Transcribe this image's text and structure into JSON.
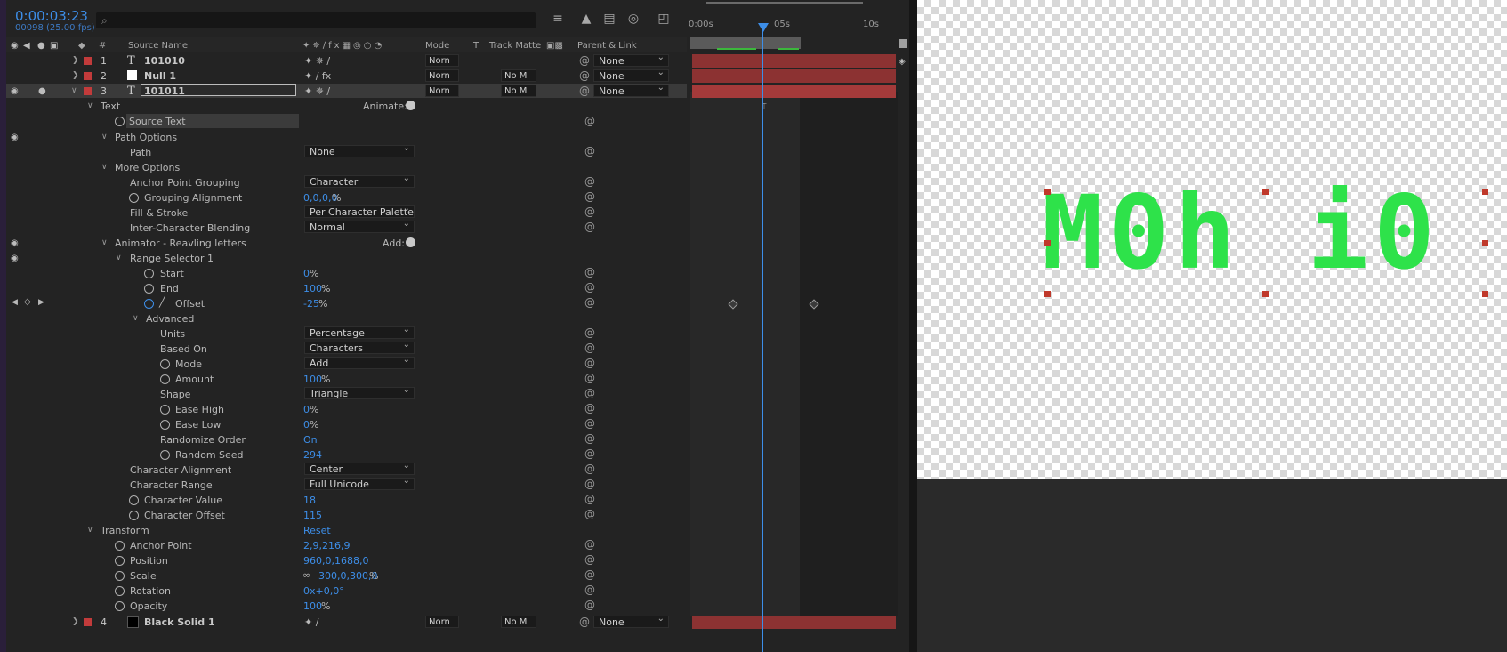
{
  "timecode": "0:00:03:23",
  "frame_info": "00098 (25.00 fps)",
  "search": {
    "placeholder": ""
  },
  "ruler": {
    "labels": [
      "0:00s",
      "05s",
      "10s"
    ]
  },
  "columns": {
    "number": "#",
    "source_name": "Source Name",
    "mode": "Mode",
    "t": "T",
    "track_matte": "Track Matte",
    "parent_link": "Parent & Link"
  },
  "layers": [
    {
      "num": "1",
      "name": "101010",
      "mode": "Norn",
      "matte": "",
      "parent": "None",
      "type": "T"
    },
    {
      "num": "2",
      "name": "Null 1",
      "mode": "Norn",
      "matte": "No M",
      "parent": "None",
      "type": "null"
    },
    {
      "num": "3",
      "name": "101011",
      "mode": "Norn",
      "matte": "No M",
      "parent": "None",
      "type": "T"
    },
    {
      "num": "4",
      "name": "Black Solid 1",
      "mode": "Norn",
      "matte": "No M",
      "parent": "None",
      "type": "solid"
    }
  ],
  "props": {
    "text": "Text",
    "animate": "Animate:",
    "source_text": "Source Text",
    "path_options": "Path Options",
    "path": "Path",
    "path_val": "None",
    "more_options": "More Options",
    "anchor_grouping": "Anchor Point Grouping",
    "anchor_grouping_val": "Character",
    "grouping_alignment": "Grouping Alignment",
    "grouping_alignment_val": "0,0,0,0",
    "fill_stroke": "Fill & Stroke",
    "fill_stroke_val": "Per Character Palette",
    "inter_char": "Inter-Character Blending",
    "inter_char_val": "Normal",
    "animator": "Animator - Reavling letters",
    "add": "Add:",
    "range_selector": "Range Selector 1",
    "start": "Start",
    "start_val": "0",
    "end": "End",
    "end_val": "100",
    "offset": "Offset",
    "offset_val": "-25",
    "advanced": "Advanced",
    "units": "Units",
    "units_val": "Percentage",
    "based_on": "Based On",
    "based_on_val": "Characters",
    "mode": "Mode",
    "mode_val": "Add",
    "amount": "Amount",
    "amount_val": "100",
    "shape": "Shape",
    "shape_val": "Triangle",
    "ease_high": "Ease High",
    "ease_high_val": "0",
    "ease_low": "Ease Low",
    "ease_low_val": "0",
    "randomize": "Randomize Order",
    "randomize_val": "On",
    "random_seed": "Random Seed",
    "random_seed_val": "294",
    "char_alignment": "Character Alignment",
    "char_alignment_val": "Center",
    "char_range": "Character Range",
    "char_range_val": "Full Unicode",
    "char_value": "Character Value",
    "char_value_val": "18",
    "char_offset": "Character Offset",
    "char_offset_val": "115",
    "transform": "Transform",
    "reset": "Reset",
    "anchor_point": "Anchor Point",
    "anchor_point_val": "2,9,216,9",
    "position": "Position",
    "position_val": "960,0,1688,0",
    "scale": "Scale",
    "scale_val": "300,0,300,0",
    "rotation": "Rotation",
    "rotation_val": "0x+0,0°",
    "opacity": "Opacity",
    "opacity_val": "100",
    "percent": "%"
  },
  "comp_view": {
    "text": "M0h i0"
  },
  "colors": {
    "accent": "#3d8ee8",
    "layer_label": "#c23b3b",
    "comp_text": "#2ee24a"
  }
}
